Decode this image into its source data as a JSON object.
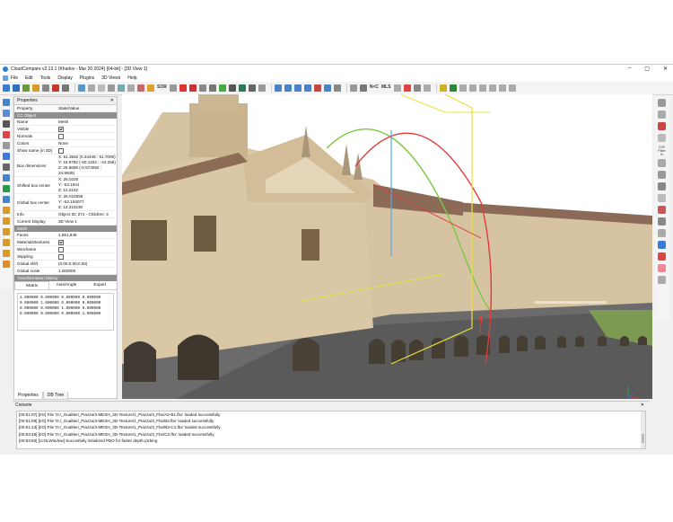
{
  "window": {
    "title": "CloudCompare v2.13.1 (Kharkiv - Mar 20 2024) [64-bit] - [3D View 1]",
    "controls": [
      "–",
      "▢",
      "✕"
    ]
  },
  "menu": [
    "File",
    "Edit",
    "Tools",
    "Display",
    "Plugins",
    "3D Views",
    "Help"
  ],
  "toolbar": {
    "sor_label": "SOR",
    "nc_label": "N<C",
    "mls_label": "MLS",
    "colors": [
      "#3a7bd5",
      "#d33",
      "#e8a23a",
      "#2a9d4a",
      "#8844aa",
      "#666",
      "#444",
      "#1c8bd1",
      "#c33",
      "#333",
      "#555",
      "#777",
      "#999",
      "#2b6",
      "#d44",
      "#ffaa00",
      "#2266cc",
      "#444"
    ]
  },
  "properties": {
    "panel_title": "Properties",
    "col_property": "Property",
    "col_value": "State/Value",
    "section_ccobject": "CC Object",
    "name_k": "Name",
    "name_v": "Mesh",
    "visible_k": "Visible",
    "normals_k": "Normals",
    "colors_k": "Colors",
    "colors_v": "None",
    "show_name_k": "Show name (in 3D)",
    "box_dim_k": "Box dimensions",
    "box_x": "X: 51.3562 (0.34448 : 51.7006)",
    "box_y": "Y: 15.8782 (-60.1332 : -44.255)",
    "box_z": "Z: 25.5668 (-0.573092 : 24.9936)",
    "shift_center_k": "Shifted box center",
    "shift_x": "X: 26.0226",
    "shift_y": "Y: -52.1941",
    "shift_z": "Z: 12.2102",
    "global_center_k": "Global box center",
    "global_x": "X: 26.022556",
    "global_y": "Y: -52.194077",
    "global_z": "Z: 12.210230",
    "info_k": "Info",
    "info_v": "Object ID: 271 - Children: 3",
    "current_display_k": "Current Display",
    "current_display_v": "3D View 1",
    "section_mesh": "Mesh",
    "faces_k": "Faces",
    "faces_v": "1,651,849",
    "materials_k": "Materials/textures",
    "wireframe_k": "Wireframe",
    "stippling_k": "Stippling",
    "global_shift_k": "Global shift",
    "global_shift_v": "(0.00;0.00;0.00)",
    "global_scale_k": "Global scale",
    "global_scale_v": "1.000000",
    "section_history": "Transformation history",
    "tab_matrix": "Matrix",
    "tab_axis": "Axis/Angle",
    "tab_export": "Export",
    "matrix_rows": [
      "1.000000 0.000000 0.000000 0.000000",
      "0.000000 1.000000 0.000000 0.000000",
      "0.000000 0.000000 1.000000 0.000000",
      "0.000000 0.000000 0.000000 1.000000"
    ]
  },
  "bottom_tabs": [
    "Properties",
    "DB Tree"
  ],
  "right_tools": {
    "csf_label": "CSF Filter",
    "n_label": "N"
  },
  "console": {
    "title": "Console",
    "lines": [
      "[00:51:07] [I/O] File 'D:/_Gualtieri_Piazza/3-MESH_3D-Texture/1_Piazza/3_Fbx/A2-B1.fbx' loaded successfully",
      "[00:51:09] [I/O] File 'D:/_Gualtieri_Piazza/3-MESH_3D-Texture/1_Piazza/3_Fbx/B2.fbx' loaded successfully",
      "[00:51:13] [I/O] File 'D:/_Gualtieri_Piazza/3-MESH_3D-Texture/1_Piazza/3_Fbx/B3-C1.fbx' loaded successfully",
      "[00:53:48] [I/O] File 'D:/_Gualtieri_Piazza/3-MESH_3D-Texture/1_Piazza/3_Fbx/C2.fbx' loaded successfully",
      "[00:53:50] [ccGLWindow] Succesfully initialized PBO for faster depth picking"
    ]
  }
}
